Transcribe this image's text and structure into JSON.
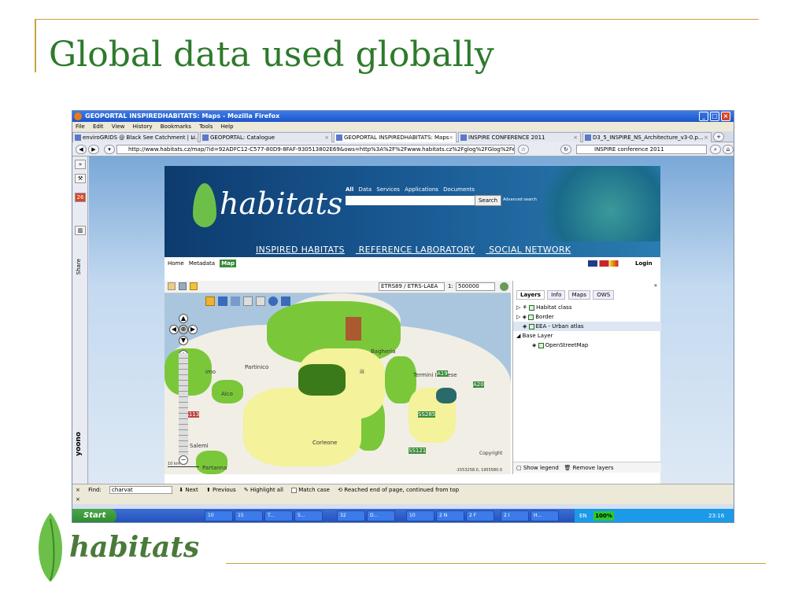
{
  "slide": {
    "title": "Global data used globally",
    "logo_text": "habitats"
  },
  "browser": {
    "window_title": "GEOPORTAL INSPIREDHABITATS: Maps - Mozilla Firefox",
    "menu": [
      "File",
      "Edit",
      "View",
      "History",
      "Bookmarks",
      "Tools",
      "Help"
    ],
    "tabs": [
      {
        "label": "enviroGRIDS @ Black See Catchment | Li...",
        "active": false
      },
      {
        "label": "GEOPORTAL: Catalogue",
        "active": false
      },
      {
        "label": "GEOPORTAL INSPIREDHABITATS: Maps",
        "active": true
      },
      {
        "label": "INSPIRE CONFERENCE 2011",
        "active": false
      },
      {
        "label": "D3_5_INSPIRE_NS_Architecture_v3-0.p...",
        "active": false
      }
    ],
    "url": "http://www.habitats.cz/map/?id=92ADFC12-C577-80D9-8FAF-930513802E69&ows=http%3A%2F%2Fwww.habitats.cz%2Fglog%2FGlog%2Fentry.php%3Fda",
    "search": "INSPIRE conference 2011",
    "sidebar_badge": "26",
    "sidebar_share": "Share",
    "sidebar_brand": "yoono"
  },
  "site": {
    "logo": "habitats",
    "top_nav": [
      "All",
      "Data",
      "Services",
      "Applications",
      "Documents"
    ],
    "search_button": "Search",
    "advanced": "Advanced search",
    "main_nav": [
      "INSPIRED HABITATS",
      "REFERENCE LABORATORY",
      "SOCIAL NETWORK"
    ],
    "sub_nav": [
      "Home",
      "Metadata",
      "Map"
    ],
    "login": "Login"
  },
  "map": {
    "projection": "ETRS89 / ETRS-LAEA",
    "scale_prefix": "1:",
    "scale": "500000",
    "places": [
      "Bagheria",
      "Partinico",
      "Alco",
      "Termini Imerese",
      "Corleone",
      "Salemi",
      "Partanna",
      "imo",
      "ili"
    ],
    "road_labels": [
      "SS113",
      "SS121",
      "SS285",
      "A20",
      "A19"
    ],
    "copyright": "Copyright",
    "coords": "-1553258.0, 1955580.0",
    "scale_bar": "10 km"
  },
  "panel": {
    "tabs": [
      "Layers",
      "Info",
      "Maps",
      "OWS"
    ],
    "layers": [
      {
        "label": "Habitat class",
        "selected": false
      },
      {
        "label": "Border",
        "selected": false
      },
      {
        "label": "EEA - Urban atlas",
        "selected": true
      }
    ],
    "base_group": "Base Layer",
    "base_layers": [
      "OpenStreetMap"
    ],
    "show_legend": "Show legend",
    "remove_layers": "Remove layers"
  },
  "findbar": {
    "label": "Find:",
    "value": "charvat",
    "next": "Next",
    "previous": "Previous",
    "highlight": "Highlight all",
    "match_case": "Match case",
    "message": "Reached end of page, continued from top"
  },
  "taskbar": {
    "start": "Start",
    "items": [
      "10",
      "15",
      "T...",
      "5...",
      "32",
      "D...",
      "10",
      "2 N",
      "2 F",
      "2 I",
      "H..."
    ],
    "lang": "EN",
    "zoom": "100%",
    "clock": "23:16"
  }
}
